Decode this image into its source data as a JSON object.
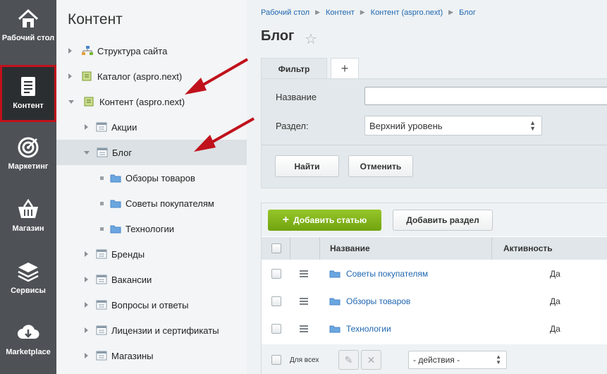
{
  "colors": {
    "accent_red": "#c0121c",
    "rail_bg": "#4e5257",
    "link": "#2067b0",
    "green_button": "#80b21b",
    "folder": "#6aa6e0"
  },
  "rail": [
    {
      "label": "Рабочий стол",
      "icon": "home-icon"
    },
    {
      "label": "Контент",
      "icon": "document-icon",
      "active": true
    },
    {
      "label": "Маркетинг",
      "icon": "target-icon"
    },
    {
      "label": "Магазин",
      "icon": "basket-icon"
    },
    {
      "label": "Сервисы",
      "icon": "layers-icon"
    },
    {
      "label": "Marketplace",
      "icon": "cloud-download-icon"
    }
  ],
  "tree": {
    "title": "Контент",
    "items": [
      {
        "label": "Структура сайта",
        "icon": "site-structure-icon"
      },
      {
        "label": "Каталог (aspro.next)",
        "icon": "iblock-icon"
      },
      {
        "label": "Контент (aspro.next)",
        "icon": "iblock-icon",
        "expanded": true
      },
      {
        "label": "Акции",
        "icon": "list-icon"
      },
      {
        "label": "Блог",
        "icon": "list-icon",
        "expanded": true,
        "selected": true
      },
      {
        "label": "Обзоры товаров",
        "icon": "folder-icon"
      },
      {
        "label": "Советы покупателям",
        "icon": "folder-icon"
      },
      {
        "label": "Технологии",
        "icon": "folder-icon"
      },
      {
        "label": "Бренды",
        "icon": "list-icon"
      },
      {
        "label": "Вакансии",
        "icon": "list-icon"
      },
      {
        "label": "Вопросы и ответы",
        "icon": "list-icon"
      },
      {
        "label": "Лицензии и сертификаты",
        "icon": "list-icon"
      },
      {
        "label": "Магазины",
        "icon": "list-icon"
      }
    ]
  },
  "breadcrumbs": [
    "Рабочий стол",
    "Контент",
    "Контент (aspro.next)",
    "Блог"
  ],
  "page": {
    "title": "Блог",
    "star": "☆"
  },
  "filter": {
    "tab_label": "Фильтр",
    "add_tab": "+",
    "name_label": "Название",
    "name_value": "",
    "section_label": "Раздел:",
    "section_value": "Верхний уровень",
    "find_button": "Найти",
    "cancel_button": "Отменить"
  },
  "grid": {
    "add_article": "Добавить статью",
    "add_section": "Добавить раздел",
    "columns": [
      "Название",
      "Активность"
    ],
    "rows": [
      {
        "name": "Советы покупателям",
        "active": "Да"
      },
      {
        "name": "Обзоры товаров",
        "active": "Да"
      },
      {
        "name": "Технологии",
        "active": "Да"
      }
    ],
    "footer": {
      "for_all": "Для всех",
      "actions": "- действия -"
    }
  }
}
